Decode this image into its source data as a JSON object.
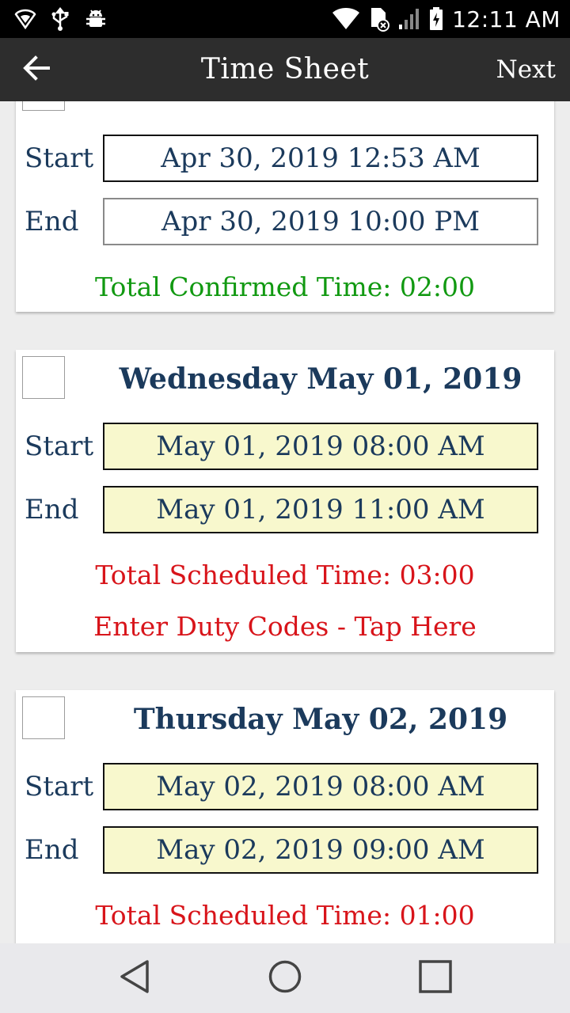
{
  "status_bar": {
    "time": "12:11 AM",
    "icons": [
      "shield-icon",
      "usb-icon",
      "android-debug-icon",
      "wifi-icon",
      "sim-card-off-icon",
      "cell-signal-icon",
      "battery-charging-icon"
    ]
  },
  "app_bar": {
    "back_icon": "arrow-left-icon",
    "title": "Time Sheet",
    "next_label": "Next"
  },
  "days": [
    {
      "title": "",
      "checked": true,
      "start_label": "Start",
      "start_value": "Apr 30, 2019 12:53 AM",
      "end_label": "End",
      "end_value": "Apr 30, 2019 10:00 PM",
      "total_text": "Total Confirmed Time: 02:00",
      "total_color": "#119911",
      "field_style": "confirmed"
    },
    {
      "title": "Wednesday May 01, 2019",
      "checked": false,
      "start_label": "Start",
      "start_value": "May 01, 2019 08:00 AM",
      "end_label": "End",
      "end_value": "May 01, 2019 11:00 AM",
      "total_text": "Total Scheduled Time: 03:00",
      "total_color": "#d8141a",
      "duty_link": "Enter Duty Codes - Tap Here",
      "field_style": "scheduled"
    },
    {
      "title": "Thursday May 02, 2019",
      "checked": false,
      "start_label": "Start",
      "start_value": "May 02, 2019 08:00 AM",
      "end_label": "End",
      "end_value": "May 02, 2019 09:00 AM",
      "total_text": "Total Scheduled Time: 01:00",
      "total_color": "#d8141a",
      "field_style": "scheduled"
    }
  ],
  "colors": {
    "app_bar": "#2d2d2d",
    "title_text": "#1b3a5c",
    "scheduled_field_bg": "#f8f8cd",
    "confirmed_total": "#119911",
    "scheduled_total": "#d8141a"
  },
  "nav_bar": {
    "icons": [
      "back-triangle-icon",
      "home-circle-icon",
      "recents-square-icon"
    ]
  }
}
